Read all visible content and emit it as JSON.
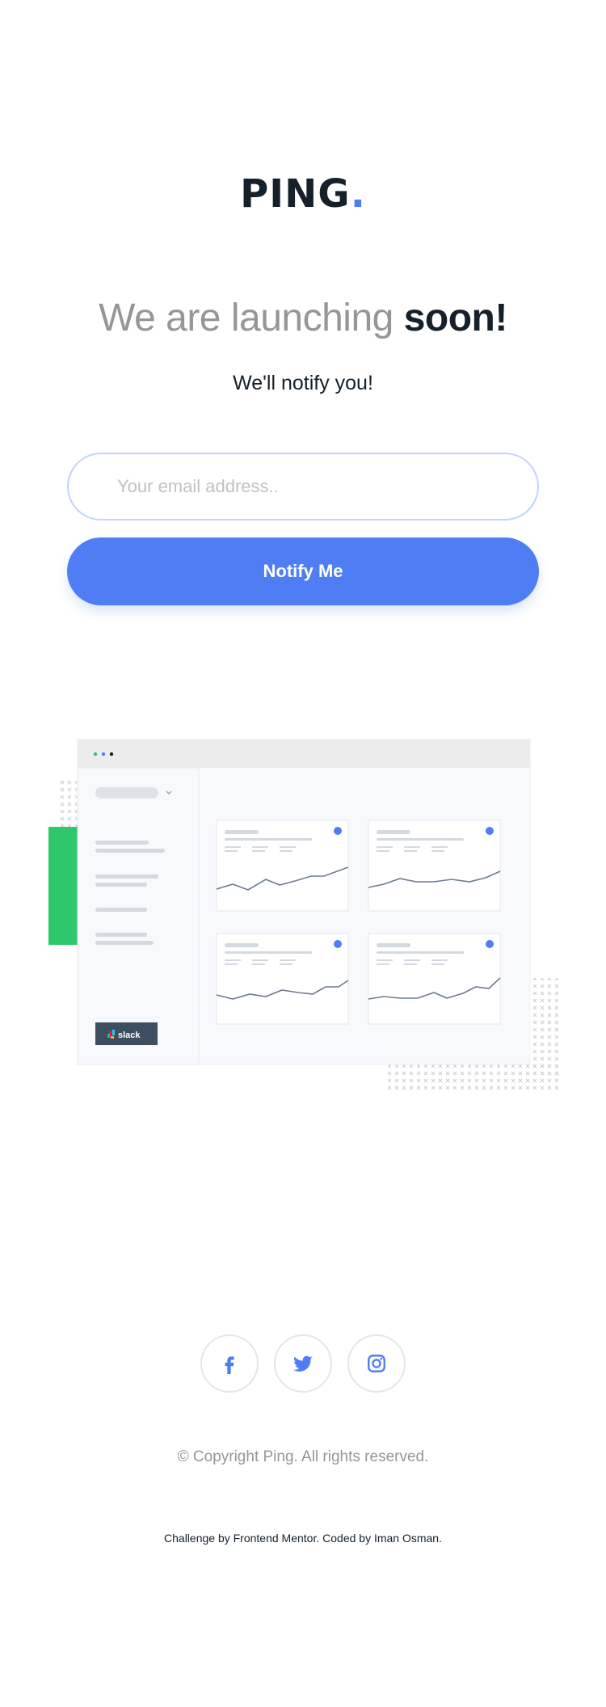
{
  "brand": {
    "name": "PING",
    "dot": ".",
    "accent": "#4f7df3"
  },
  "hero": {
    "headline_light": "We are launching",
    "headline_bold": "soon!",
    "subtitle": "We'll notify you!"
  },
  "form": {
    "email_placeholder": "Your email address..",
    "email_value": "",
    "submit_label": "Notify Me"
  },
  "illustration": {
    "sidebar_badge": "slack"
  },
  "socials": [
    {
      "name": "facebook-icon"
    },
    {
      "name": "twitter-icon"
    },
    {
      "name": "instagram-icon"
    }
  ],
  "footer": {
    "copyright": "© Copyright Ping. All rights reserved.",
    "credit": "Challenge by Frontend Mentor. Coded by Iman Osman."
  },
  "colors": {
    "primary": "#4f7df3",
    "dark": "#15202a",
    "gray": "#969696",
    "green": "#2ec76b"
  }
}
